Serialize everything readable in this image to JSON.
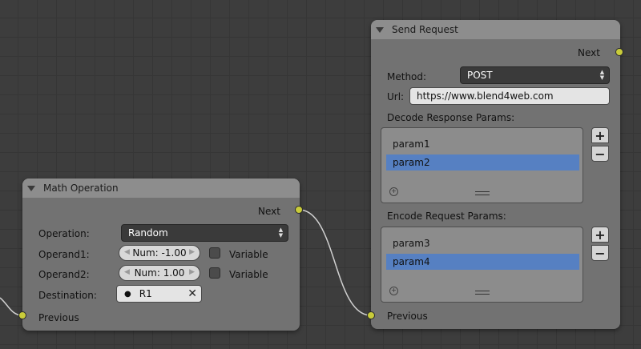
{
  "math_node": {
    "title": "Math Operation",
    "next_label": "Next",
    "operation_label": "Operation:",
    "operation_value": "Random",
    "operand1_label": "Operand1:",
    "operand1_value": "Num: -1.00",
    "operand2_label": "Operand2:",
    "operand2_value": "Num: 1.00",
    "variable_label": "Variable",
    "destination_label": "Destination:",
    "destination_value": "R1",
    "previous_label": "Previous"
  },
  "send_node": {
    "title": "Send Request",
    "next_label": "Next",
    "method_label": "Method:",
    "method_value": "POST",
    "url_label": "Url:",
    "url_value": "https://www.blend4web.com",
    "decode_label": "Decode Response Params:",
    "decode_params": [
      "param1",
      "param2"
    ],
    "encode_label": "Encode Request Params:",
    "encode_params": [
      "param3",
      "param4"
    ],
    "add_symbol": "+",
    "remove_symbol": "−",
    "previous_label": "Previous"
  },
  "colors": {
    "socket": "#c9cc3a",
    "selection": "#5680c2",
    "node_body": "#727272",
    "node_header": "#8d8d8d"
  }
}
